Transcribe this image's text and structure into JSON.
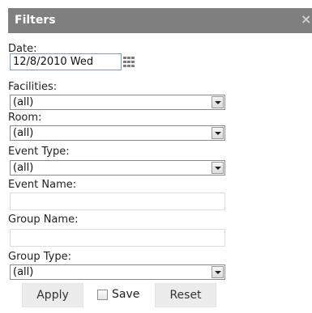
{
  "header": {
    "title": "Filters",
    "close_glyph": "×"
  },
  "date": {
    "label": "Date:",
    "value": "12/8/2010 Wed",
    "icon": "calendar-icon"
  },
  "facilities": {
    "label": "Facilities:",
    "value": "(all)"
  },
  "room": {
    "label": "Room:",
    "value": "(all)"
  },
  "event_type": {
    "label": "Event Type:",
    "value": "(all)"
  },
  "event_name": {
    "label": "Event Name:",
    "value": ""
  },
  "group_name": {
    "label": "Group Name:",
    "value": ""
  },
  "group_type": {
    "label": "Group Type:",
    "value": "(all)"
  },
  "actions": {
    "apply_label": "Apply",
    "save_label": "Save",
    "save_checked": false,
    "reset_label": "Reset"
  }
}
